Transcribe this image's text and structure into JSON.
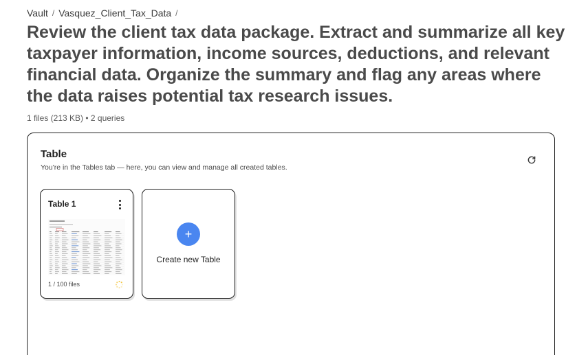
{
  "breadcrumb": {
    "items": [
      "Vault",
      "Vasquez_Client_Tax_Data"
    ],
    "separator": "/"
  },
  "page": {
    "title": "Review the client tax data package. Extract and summarize all key taxpayer information, income sources, deductions, and relevant financial data. Organize the summary and flag any areas where the data raises potential tax research issues.",
    "meta": "1 files (213 KB) • 2 queries"
  },
  "panel": {
    "title": "Table",
    "subtitle": "You're in the Tables tab — here, you can view and manage all created tables.",
    "refresh_icon": "refresh-icon"
  },
  "cards": {
    "table1": {
      "title": "Table 1",
      "files": "1 / 100 files",
      "status": "loading",
      "menu_icon": "more-vertical-icon"
    },
    "create": {
      "label": "Create new Table",
      "icon": "plus-icon",
      "icon_glyph": "+"
    }
  },
  "colors": {
    "accent": "#4a86f0",
    "spinner": "#f2c230",
    "title_text": "#4a4a4a",
    "border": "#1f1f1f"
  }
}
